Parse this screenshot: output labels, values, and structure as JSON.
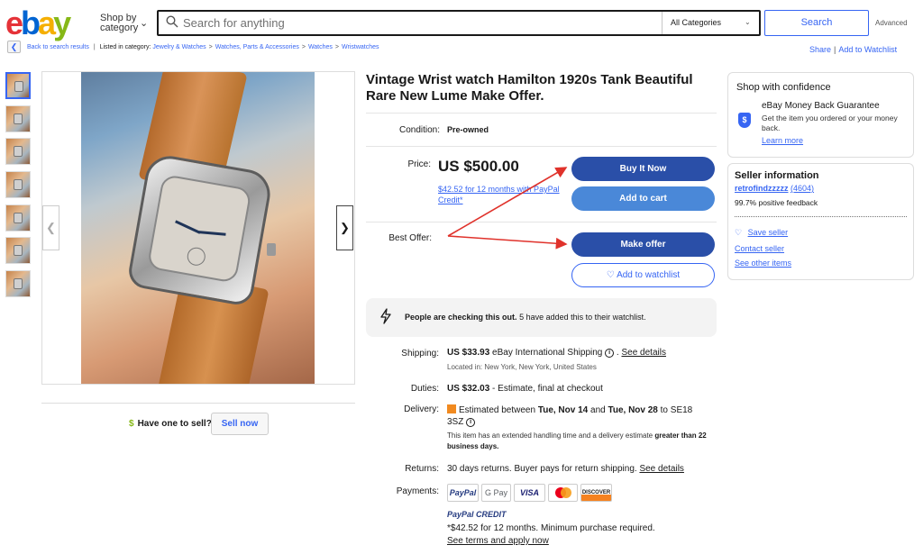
{
  "header": {
    "logo": {
      "e": "e",
      "b": "b",
      "a": "a",
      "y": "y"
    },
    "shop_by": "Shop by",
    "category": "category",
    "search_placeholder": "Search for anything",
    "category_select": "All Categories",
    "search_button": "Search",
    "advanced": "Advanced"
  },
  "breadcrumb": {
    "back_label": "Back to search results",
    "listed_in": "Listed in category:",
    "items": [
      "Jewelry & Watches",
      "Watches, Parts & Accessories",
      "Watches",
      "Wristwatches"
    ],
    "share": "Share",
    "watchlist": "Add to Watchlist"
  },
  "gallery": {
    "thumb_count": 7,
    "have_one": "Have one to sell?",
    "sell_now": "Sell now"
  },
  "listing": {
    "title": "Vintage Wrist watch Hamilton 1920s Tank Beautiful Rare New Lume Make Offer.",
    "condition_label": "Condition:",
    "condition_value": "Pre-owned",
    "price_label": "Price:",
    "price": "US $500.00",
    "paypal_monthly": "$42.52 for 12 months with PayPal Credit*",
    "best_offer_label": "Best Offer:",
    "buy_now": "Buy It Now",
    "add_to_cart": "Add to cart",
    "make_offer": "Make offer",
    "add_watchlist": "Add to watchlist",
    "notice_bold": "People are checking this out.",
    "notice_rest": "5 have added this to their watchlist.",
    "shipping_label": "Shipping:",
    "shipping_cost": "US $33.93",
    "shipping_method": "eBay International Shipping",
    "see_details": "See details",
    "located": "Located in: New York, New York, United States",
    "duties_label": "Duties:",
    "duties_cost": "US $32.03",
    "duties_note": "- Estimate, final at checkout",
    "delivery_label": "Delivery:",
    "delivery_pre": "Estimated between",
    "delivery_date1": "Tue, Nov 14",
    "delivery_and": "and",
    "delivery_date2": "Tue, Nov 28",
    "delivery_to": "to SE18",
    "delivery_zip": "3SZ",
    "delivery_note1": "This item has an extended handling time and a delivery estimate",
    "delivery_note_bold": "greater than 22 business days.",
    "returns_label": "Returns:",
    "returns_value": "30 days returns. Buyer pays for return shipping.",
    "returns_link": "See details",
    "payments_label": "Payments:",
    "payment_methods": [
      "PayPal",
      "G Pay",
      "VISA",
      "",
      "DISCOVER"
    ],
    "paypal_credit": "PayPal CREDIT",
    "credit_terms": "*$42.52 for 12 months. Minimum purchase required.",
    "see_terms": "See terms and apply now"
  },
  "confidence": {
    "heading": "Shop with confidence",
    "guarantee_title": "eBay Money Back Guarantee",
    "guarantee_text": "Get the item you ordered or your money back.",
    "learn_more": "Learn more"
  },
  "seller": {
    "heading": "Seller information",
    "name": "retrofindzzzzz",
    "score": "(4604)",
    "feedback": "99.7% positive feedback",
    "save_seller": "Save seller",
    "contact": "Contact seller",
    "other_items": "See other items"
  },
  "colors": {
    "accent": "#3665f3",
    "dark_button": "#2a4fa8",
    "annotation_arrow": "#e0322b"
  }
}
